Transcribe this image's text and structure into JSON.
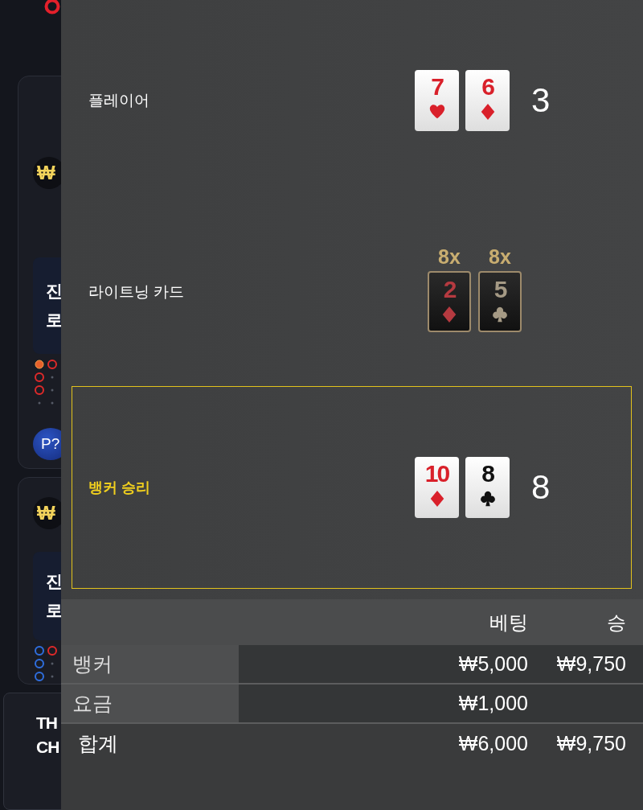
{
  "background": {
    "cards": [
      {
        "currency": "₩",
        "message_lines": [
          "진",
          "로"
        ],
        "badge": "P?"
      },
      {
        "currency": "₩",
        "message_lines": [
          "진",
          "로"
        ]
      }
    ],
    "notice_lines": [
      "TH",
      "CH"
    ]
  },
  "result": {
    "outcomes": [
      {
        "label": "플레이어",
        "kind": "hand",
        "selected": false,
        "score": "3",
        "cards": [
          {
            "rank": "7",
            "kind": "hearts"
          },
          {
            "rank": "6",
            "kind": "diamonds"
          }
        ]
      },
      {
        "label": "라이트닝 카드",
        "kind": "lightning",
        "selected": false,
        "cards": [
          {
            "rank": "2",
            "kind": "diamonds",
            "multiplier": "8x"
          },
          {
            "rank": "5",
            "kind": "clubs",
            "multiplier": "8x"
          }
        ]
      },
      {
        "label": "뱅커 승리",
        "kind": "hand",
        "selected": true,
        "score": "8",
        "cards": [
          {
            "rank": "10",
            "kind": "diamonds"
          },
          {
            "rank": "8",
            "kind": "clubs"
          }
        ]
      }
    ]
  },
  "bets": {
    "columns": [
      "베팅",
      "승"
    ],
    "rows": [
      {
        "label": "뱅커",
        "bet": "₩5,000",
        "win": "₩9,750"
      },
      {
        "label": "요금",
        "bet": "₩1,000"
      }
    ],
    "total": {
      "label": "합계",
      "bet": "₩6,000",
      "win": "₩9,750"
    }
  }
}
